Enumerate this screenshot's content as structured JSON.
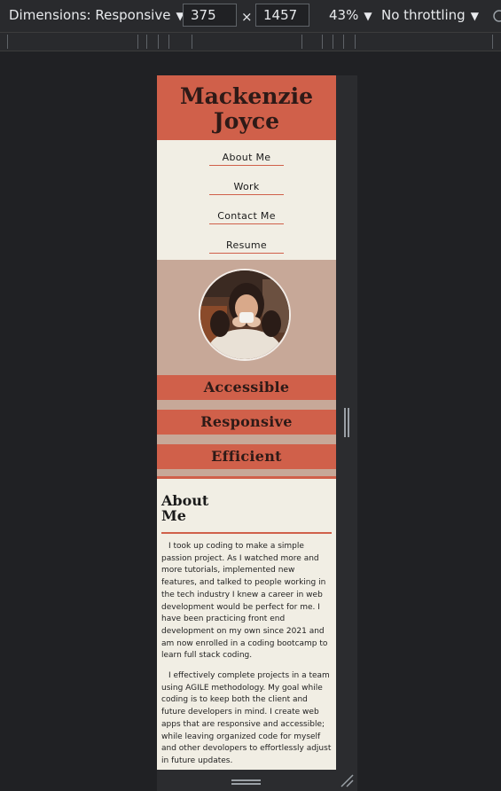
{
  "devtools": {
    "dimensions_label": "Dimensions: Responsive",
    "width_value": "375",
    "height_value": "1457",
    "times_symbol": "×",
    "zoom_label": "43%",
    "throttling_label": "No throttling"
  },
  "page": {
    "title": "Mackenzie Joyce",
    "nav": [
      "About Me",
      "Work",
      "Contact Me",
      "Resume"
    ],
    "features": [
      "Accessible",
      "Responsive",
      "Efficient"
    ],
    "about": {
      "heading": "About Me",
      "paragraphs": [
        "I took up coding to make a simple passion project. As I watched more and more tutorials, implemented new features, and talked to people working in the tech industry I knew a career in web development would be perfect for me. I have been practicing front end development on my own since 2021 and am now enrolled in a coding bootcamp to learn full stack coding.",
        "I effectively complete projects in a team using AGILE methodology. My goal while coding is to keep both the client and future developers in mind. I create web apps that are responsive and accessible; while leaving organized code for myself and other devolopers to effortlessly adjust in future updates."
      ]
    }
  },
  "colors": {
    "accent": "#d0604a",
    "cream": "#f1eee4",
    "hero": "#c7a898",
    "devtools_bg": "#202124"
  }
}
